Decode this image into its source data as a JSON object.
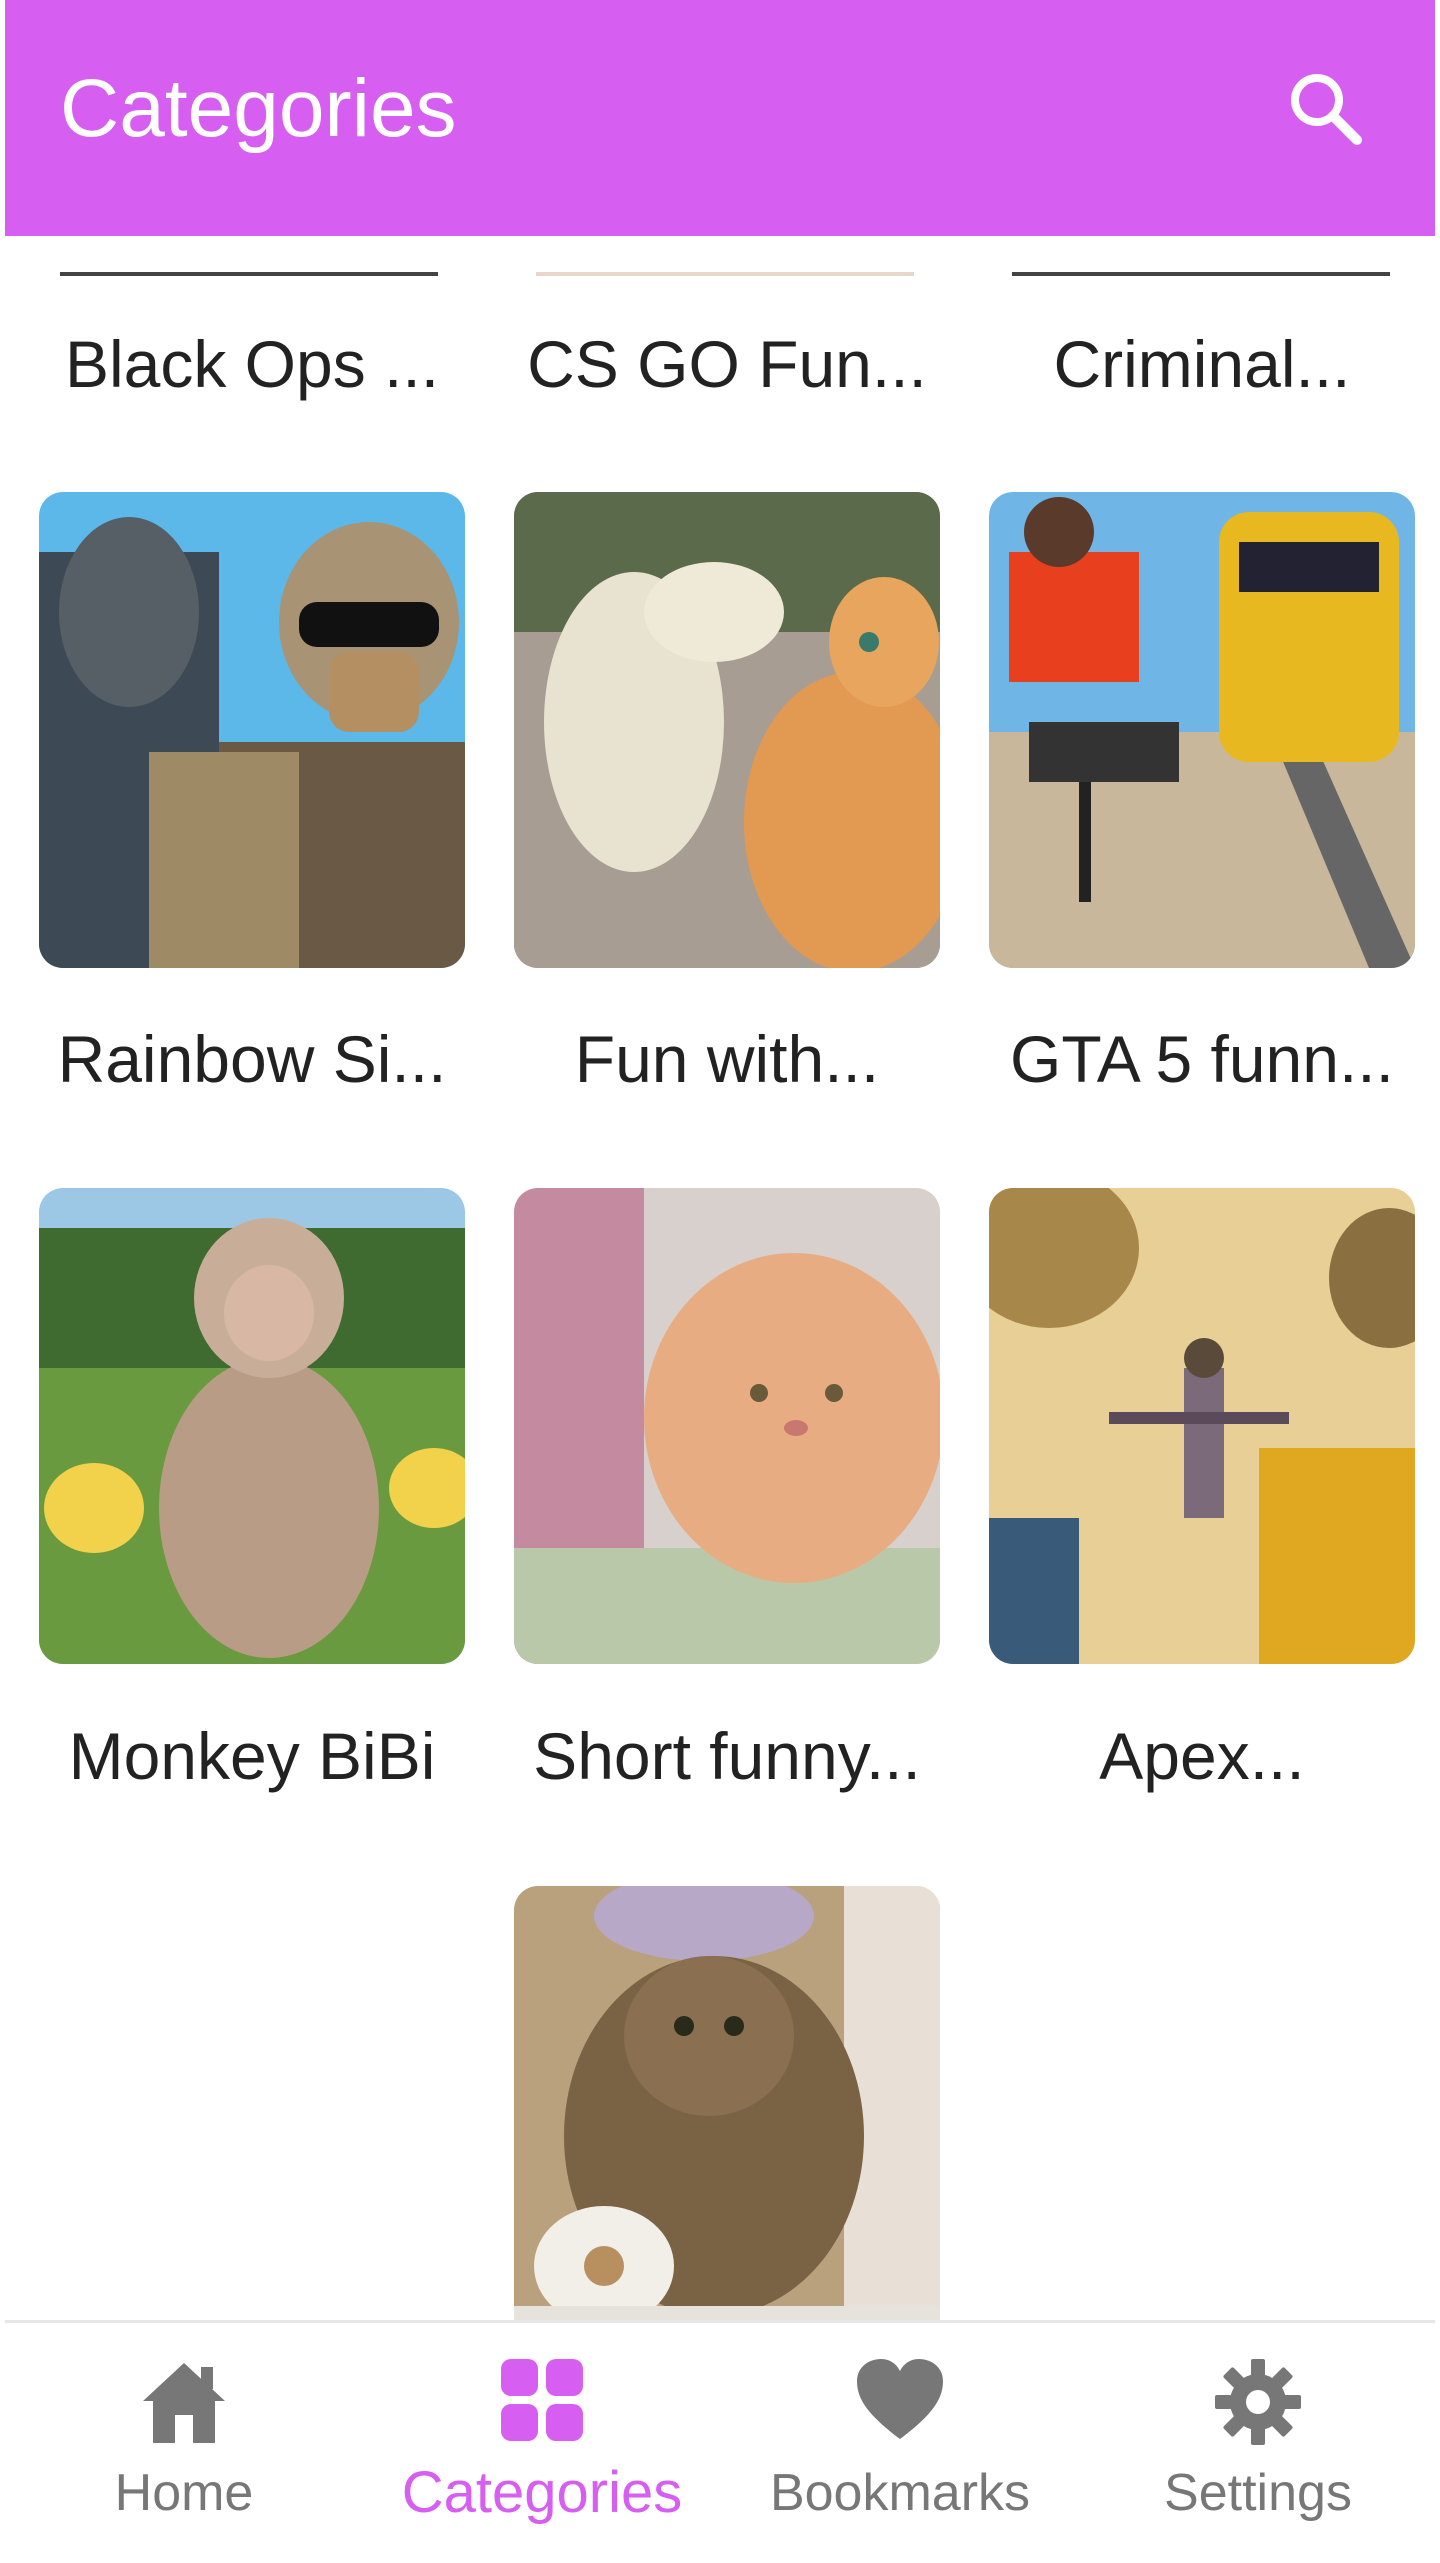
{
  "appbar": {
    "title": "Categories",
    "search_icon": "search-icon"
  },
  "colors": {
    "accent": "#d65ef0",
    "nav_inactive": "#777777",
    "text": "#222222"
  },
  "top_row_labels": [
    "Black Ops ...",
    "CS GO Fun...",
    "Criminal..."
  ],
  "grid": [
    {
      "label": "Rainbow Si..."
    },
    {
      "label": "Fun with..."
    },
    {
      "label": "GTA 5 funn..."
    },
    {
      "label": "Monkey BiBi"
    },
    {
      "label": "Short funny..."
    },
    {
      "label": "Apex..."
    }
  ],
  "bottom_nav": [
    {
      "label": "Home",
      "icon": "home-icon"
    },
    {
      "label": "Categories",
      "icon": "categories-grid-icon",
      "active": true
    },
    {
      "label": "Bookmarks",
      "icon": "heart-icon"
    },
    {
      "label": "Settings",
      "icon": "gear-icon"
    }
  ]
}
